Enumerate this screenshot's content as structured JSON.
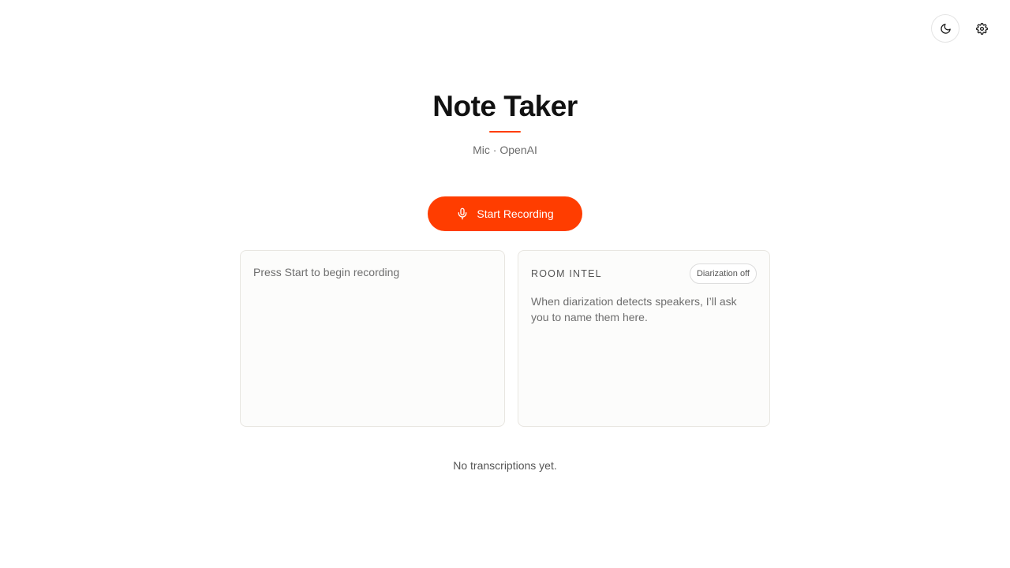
{
  "app": {
    "title": "Note Taker",
    "subtitle": "Mic · OpenAI",
    "accent_color": "#ff3d00"
  },
  "top_controls": {
    "theme_icon": "moon-icon",
    "settings_icon": "gear-icon"
  },
  "record": {
    "label": "Start Recording",
    "icon": "microphone-icon"
  },
  "transcript_panel": {
    "placeholder": "Press Start to begin recording"
  },
  "room_intel": {
    "title": "ROOM INTEL",
    "badge": "Diarization off",
    "message": "When diarization detects speakers, I’ll ask you to name them here."
  },
  "transcriptions": {
    "empty_text": "No transcriptions yet."
  }
}
